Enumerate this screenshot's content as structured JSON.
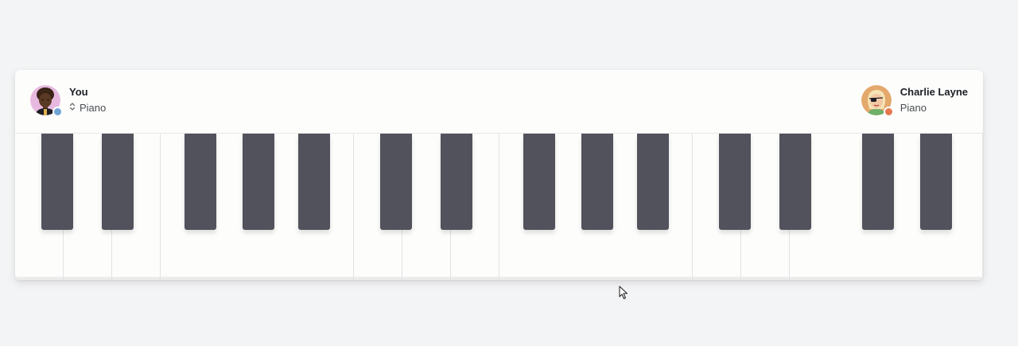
{
  "players": {
    "self": {
      "name": "You",
      "instrument": "Piano",
      "status_color": "#6ea3d6",
      "avatar_bg": "#e8b9e0"
    },
    "other": {
      "name": "Charlie Layne",
      "instrument": "Piano",
      "status_color": "#e5784d",
      "avatar_bg": "#e3a86c"
    }
  },
  "keyboard": {
    "white_key_count": 20,
    "black_key_count": 14,
    "black_key_color": "#52525c",
    "white_key_color": "#fdfdfc"
  },
  "icons": {
    "instrument_selector": "chevron-up-down-icon",
    "cursor": "mouse-pointer-icon"
  }
}
